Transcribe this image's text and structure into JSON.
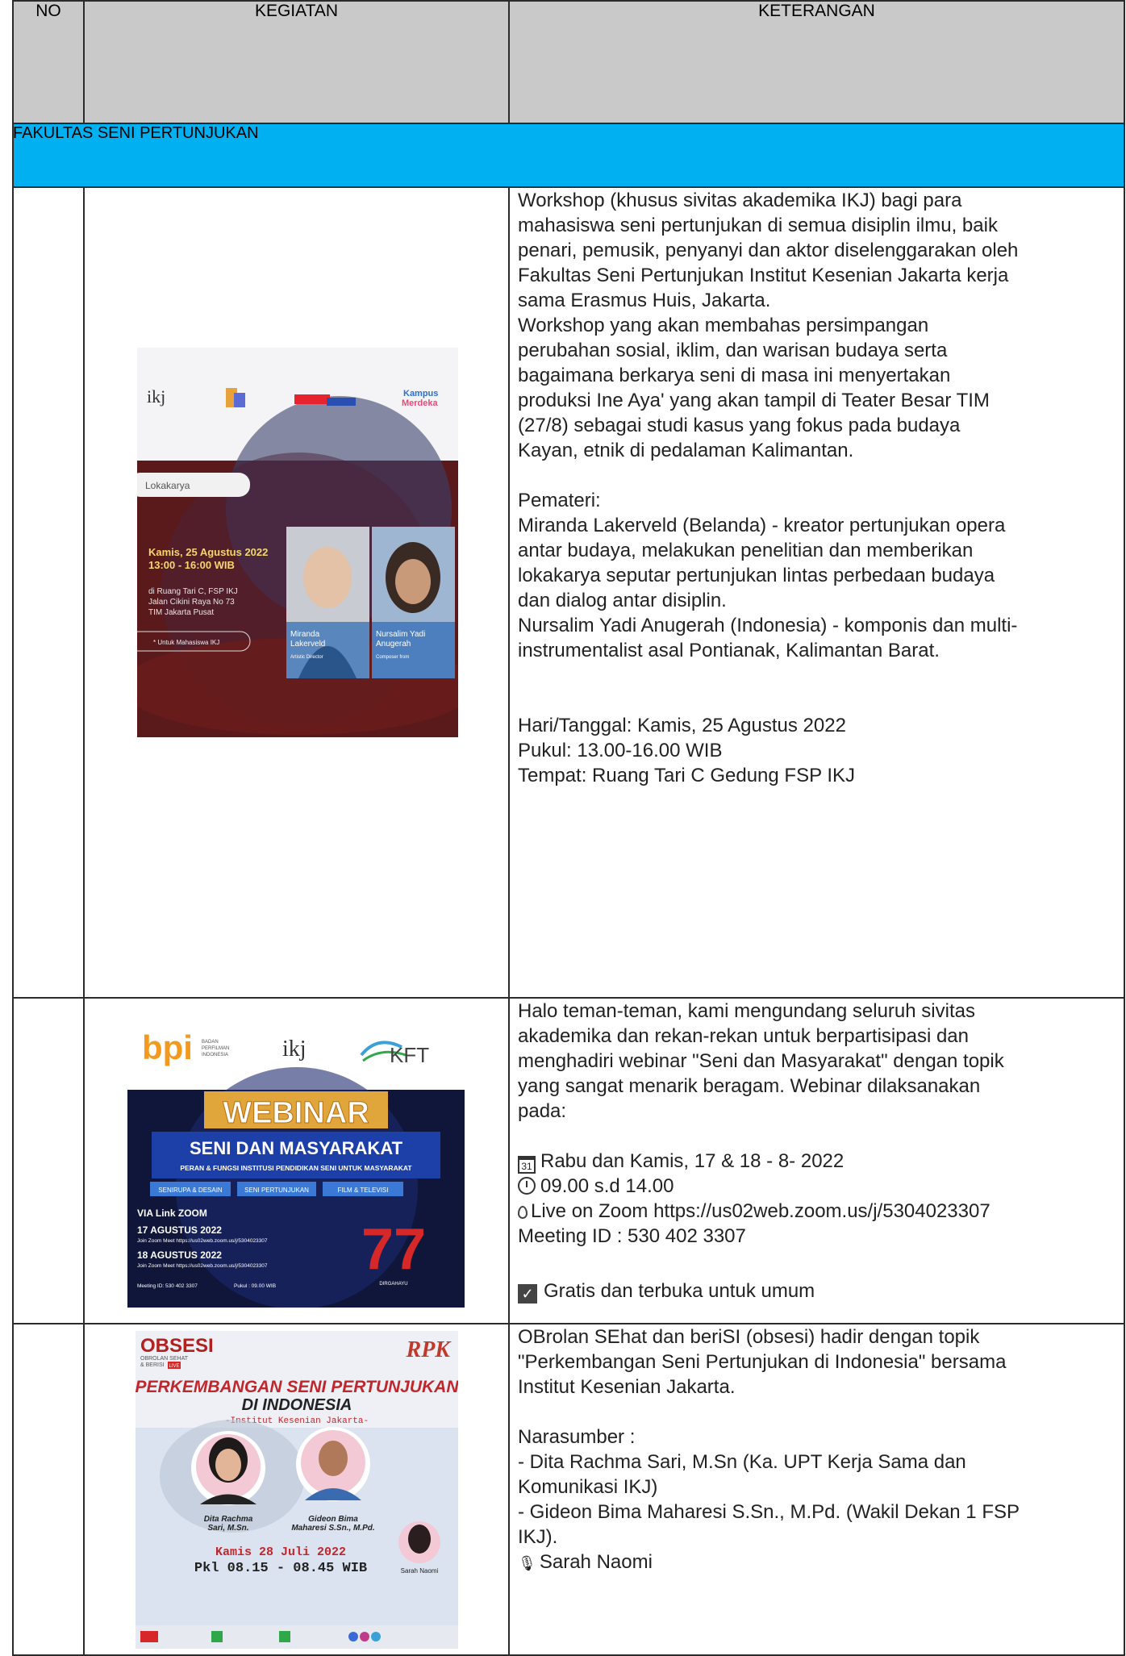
{
  "header": {
    "col_no": "NO",
    "col_kegiatan": "KEGIATAN",
    "col_keterangan": "KETERANGAN"
  },
  "section_title": "FAKULTAS SENI PERTUNJUKAN",
  "rows": [
    {
      "poster": {
        "logo_ikj": "ikj",
        "logo_kampus": "Kampus Merdeka",
        "tag": "Lokakarya",
        "date_line1": "Kamis, 25 Agustus 2022",
        "date_line2": "13:00 - 16:00 WIB",
        "venue_line1": "di Ruang Tari C, FSP IKJ",
        "venue_line2": "Jalan Cikini Raya No 73",
        "venue_line3": "TIM Jakarta Pusat",
        "note": "* Untuk Mahasiswa IKJ",
        "speaker1_name": "Miranda Lakerveld",
        "speaker1_role": "Artistic Director",
        "speaker2_name": "Nursalim Yadi Anugerah",
        "speaker2_role": "Composer from Kalimantan"
      },
      "lines": [
        "Workshop (khusus sivitas akademika IKJ) bagi para",
        "mahasiswa seni pertunjukan di semua disiplin ilmu, baik",
        "penari, pemusik, penyanyi dan aktor diselenggarakan oleh",
        "Fakultas Seni Pertunjukan Institut Kesenian Jakarta kerja",
        "sama Erasmus Huis, Jakarta.",
        "Workshop yang akan membahas persimpangan",
        "perubahan sosial, iklim, dan warisan budaya serta",
        "bagaimana berkarya seni di masa ini menyertakan",
        "produksi Ine Aya' yang akan tampil di Teater Besar TIM",
        "(27/8) sebagai studi kasus yang fokus pada budaya",
        "Kayan, etnik di pedalaman Kalimantan.",
        "",
        "Pemateri:",
        "Miranda Lakerveld (Belanda) - kreator pertunjukan opera",
        "antar budaya, melakukan penelitian dan memberikan",
        "lokakarya seputar pertunjukan lintas perbedaan budaya",
        "dan dialog antar disiplin.",
        "Nursalim Yadi Anugerah (Indonesia) - komponis dan multi-",
        "instrumentalist asal Pontianak, Kalimantan Barat.",
        "",
        "",
        "Hari/Tanggal: Kamis, 25 Agustus 2022",
        "Pukul: 13.00-16.00 WIB",
        "Tempat: Ruang Tari C Gedung FSP IKJ"
      ]
    },
    {
      "poster": {
        "logo_bpi": "bpi",
        "logo_bpi_sub": "BADAN PERFILMAN INDONESIA",
        "logo_kft": "KFT",
        "banner": "WEBINAR",
        "title": "SENI DAN MASYARAKAT",
        "subtitle": "PERAN & FUNGSI INSTITUSI PENDIDIKAN SENI UNTUK MASYARAKAT",
        "tab1": "SENIRUPA & DESAIN",
        "tab2": "SENI PERTUNJUKAN",
        "tab3": "FILM & TELEVISI",
        "via": "VIA Link ZOOM",
        "date1": "17 AGUSTUS 2022",
        "link1": "Join Zoom Meet https://us02web.zoom.us/j/5304023307",
        "date2": "18 AGUSTUS 2022",
        "link2": "Join Zoom Meet https://us02web.zoom.us/j/5304023307",
        "meeting": "Meeting ID: 530 402 3307",
        "time": "Pukul : 09.00 WIB",
        "anniv": "77",
        "anniv_sub": "DIRGAHAYU"
      },
      "intro_lines": [
        "Halo teman-teman, kami mengundang seluruh sivitas",
        "akademika dan rekan-rekan untuk berpartisipasi dan",
        "menghadiri webinar \"Seni dan Masyarakat\" dengan topik",
        "yang sangat menarik beragam. Webinar dilaksanakan",
        "pada:"
      ],
      "date_text": "Rabu dan Kamis, 17 & 18 - 8- 2022",
      "cal_num": "31",
      "time_text": "09.00 s.d 14.00",
      "zoom_text": "Live on Zoom https://us02web.zoom.us/j/5304023307",
      "meeting_text": "Meeting ID : 530 402 3307",
      "free_text": "Gratis dan terbuka untuk umum",
      "check_glyph": "✓"
    },
    {
      "poster": {
        "brand": "OBSESI",
        "brand_sub": "OBROLAN SEHAT & BERISI",
        "live": "LIVE",
        "radio": "RPK",
        "title1": "PERKEMBANGAN SENI PERTUNJUKAN",
        "title2": "DI INDONESIA",
        "org": "-Institut Kesenian Jakarta-",
        "p1_name": "Dita Rachma Sari, M.Sn.",
        "p2_name": "Gideon Bima Maharesi S.Sn., M.Pd.",
        "p3_name": "Sarah Naomi",
        "date": "Kamis 28 Juli 2022",
        "time": "Pkl 08.15 - 08.45 WIB"
      },
      "lines": [
        "OBrolan SEhat dan beriSI (obsesi) hadir dengan topik",
        "\"Perkembangan Seni Pertunjukan di Indonesia\" bersama",
        "Institut Kesenian Jakarta.",
        "",
        "Narasumber :",
        "- Dita Rachma Sari, M.Sn (Ka. UPT Kerja Sama dan",
        "Komunikasi IKJ)",
        "- Gideon Bima Maharesi S.Sn., M.Pd. (Wakil Dekan 1 FSP",
        "IKJ)."
      ],
      "host_text": "Sarah Naomi",
      "mic_glyph": "🎙"
    }
  ]
}
